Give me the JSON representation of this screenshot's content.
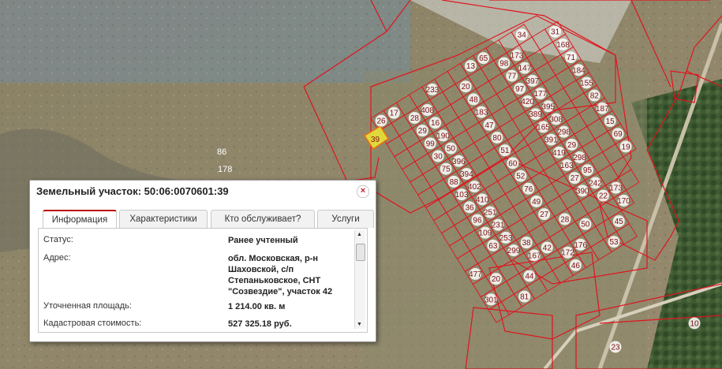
{
  "map": {
    "free_labels": [
      "86",
      "178"
    ],
    "selected_parcel": "39",
    "parcel_numbers": [
      "26",
      "13",
      "28",
      "98",
      "29",
      "77",
      "99",
      "97",
      "30",
      "420",
      "75",
      "389",
      "88",
      "165",
      "103",
      "391",
      "36",
      "419",
      "96",
      "163",
      "109",
      "27",
      "63",
      "390",
      "299",
      "22",
      "167",
      "170",
      "172",
      "81",
      "53",
      "10",
      "233",
      "34",
      "20",
      "31",
      "48",
      "168",
      "183",
      "71",
      "47",
      "184",
      "80",
      "155",
      "51",
      "82",
      "60",
      "187",
      "52",
      "15",
      "76",
      "69",
      "49",
      "19",
      "27",
      "477",
      "28",
      "20",
      "50",
      "44",
      "45",
      "46",
      "23",
      "17",
      "65",
      "408",
      "173",
      "16",
      "147",
      "190",
      "397",
      "50",
      "177",
      "396",
      "395",
      "394",
      "308",
      "402",
      "298",
      "410",
      "29",
      "251",
      "298",
      "231",
      "95",
      "253",
      "242",
      "38",
      "173",
      "42",
      "301",
      "176"
    ]
  },
  "popup": {
    "title": "Земельный участок: 50:06:0070601:39",
    "close_glyph": "×",
    "tabs": [
      "Информация",
      "Характеристики",
      "Кто обслуживает?",
      "Услуги"
    ],
    "active_tab": "Информация",
    "rows": [
      {
        "label": "Статус:",
        "value": "Ранее учтенный"
      },
      {
        "label": "Адрес:",
        "value": "обл. Московская, р-н Шаховской, с/п Степаньковское, СНТ \"Созвездие\", участок 42"
      },
      {
        "label": "Уточненная площадь:",
        "value": "1 214.00 кв. м"
      },
      {
        "label": "Кадастровая стоимость:",
        "value": "527 325.18 руб."
      }
    ]
  }
}
